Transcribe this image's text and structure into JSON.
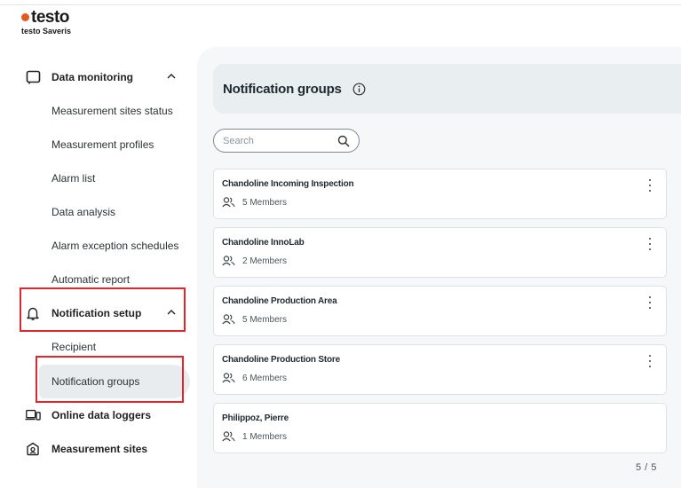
{
  "brand": {
    "logo_text": "testo",
    "product": "testo Saveris"
  },
  "sidebar": {
    "sections": [
      {
        "label": "Data monitoring",
        "icon": "monitor-icon",
        "expanded": true,
        "items": [
          "Measurement sites status",
          "Measurement profiles",
          "Alarm list",
          "Data analysis",
          "Alarm exception schedules",
          "Automatic report"
        ]
      },
      {
        "label": "Notification setup",
        "icon": "bell-icon",
        "expanded": true,
        "items": [
          "Recipient",
          "Notification groups"
        ]
      },
      {
        "label": "Online data loggers",
        "icon": "devices-icon"
      },
      {
        "label": "Measurement sites",
        "icon": "location-icon"
      }
    ],
    "active_item": "Notification groups"
  },
  "page": {
    "title": "Notification groups"
  },
  "search": {
    "placeholder": "Search",
    "value": ""
  },
  "groups": [
    {
      "name": "Chandoline Incoming Inspection",
      "members": "5 Members"
    },
    {
      "name": "Chandoline InnoLab",
      "members": "2 Members"
    },
    {
      "name": "Chandoline Production Area",
      "members": "5 Members"
    },
    {
      "name": "Chandoline Production Store",
      "members": "6 Members"
    },
    {
      "name": "Philippoz, Pierre",
      "members": "1 Members"
    }
  ],
  "pagination": {
    "text": "5 / 5"
  },
  "colors": {
    "brand_orange": "#e4571f",
    "highlight_red": "#e0262f",
    "active_bg": "#e8ecee",
    "header_bg": "#e9eef0"
  }
}
